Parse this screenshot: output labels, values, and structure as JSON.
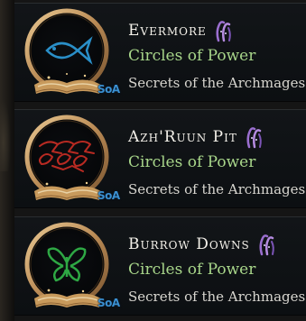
{
  "colors": {
    "background": "#151515",
    "card_background": "#0f1215",
    "title": "#f4f1ea",
    "category": "#a8d68a",
    "source": "#d8d6d0",
    "icon_fish": "#2a8fc8",
    "icon_pit": "#b82a22",
    "icon_butterfly": "#2ea844",
    "badge": "#3a8fd0",
    "tentacle": "#9b6fd0"
  },
  "cards": [
    {
      "title": "Evermore",
      "category": "Circles of Power",
      "source": "Secrets of the Archmages:",
      "badge": "SoA",
      "icon": "fish-icon"
    },
    {
      "title": "Azh'Ruun Pit",
      "category": "Circles of Power",
      "source": "Secrets of the Archmages:",
      "badge": "SoA",
      "icon": "pit-icon"
    },
    {
      "title": "Burrow Downs",
      "category": "Circles of Power",
      "source": "Secrets of the Archmages:",
      "badge": "SoA",
      "icon": "butterfly-icon"
    }
  ]
}
